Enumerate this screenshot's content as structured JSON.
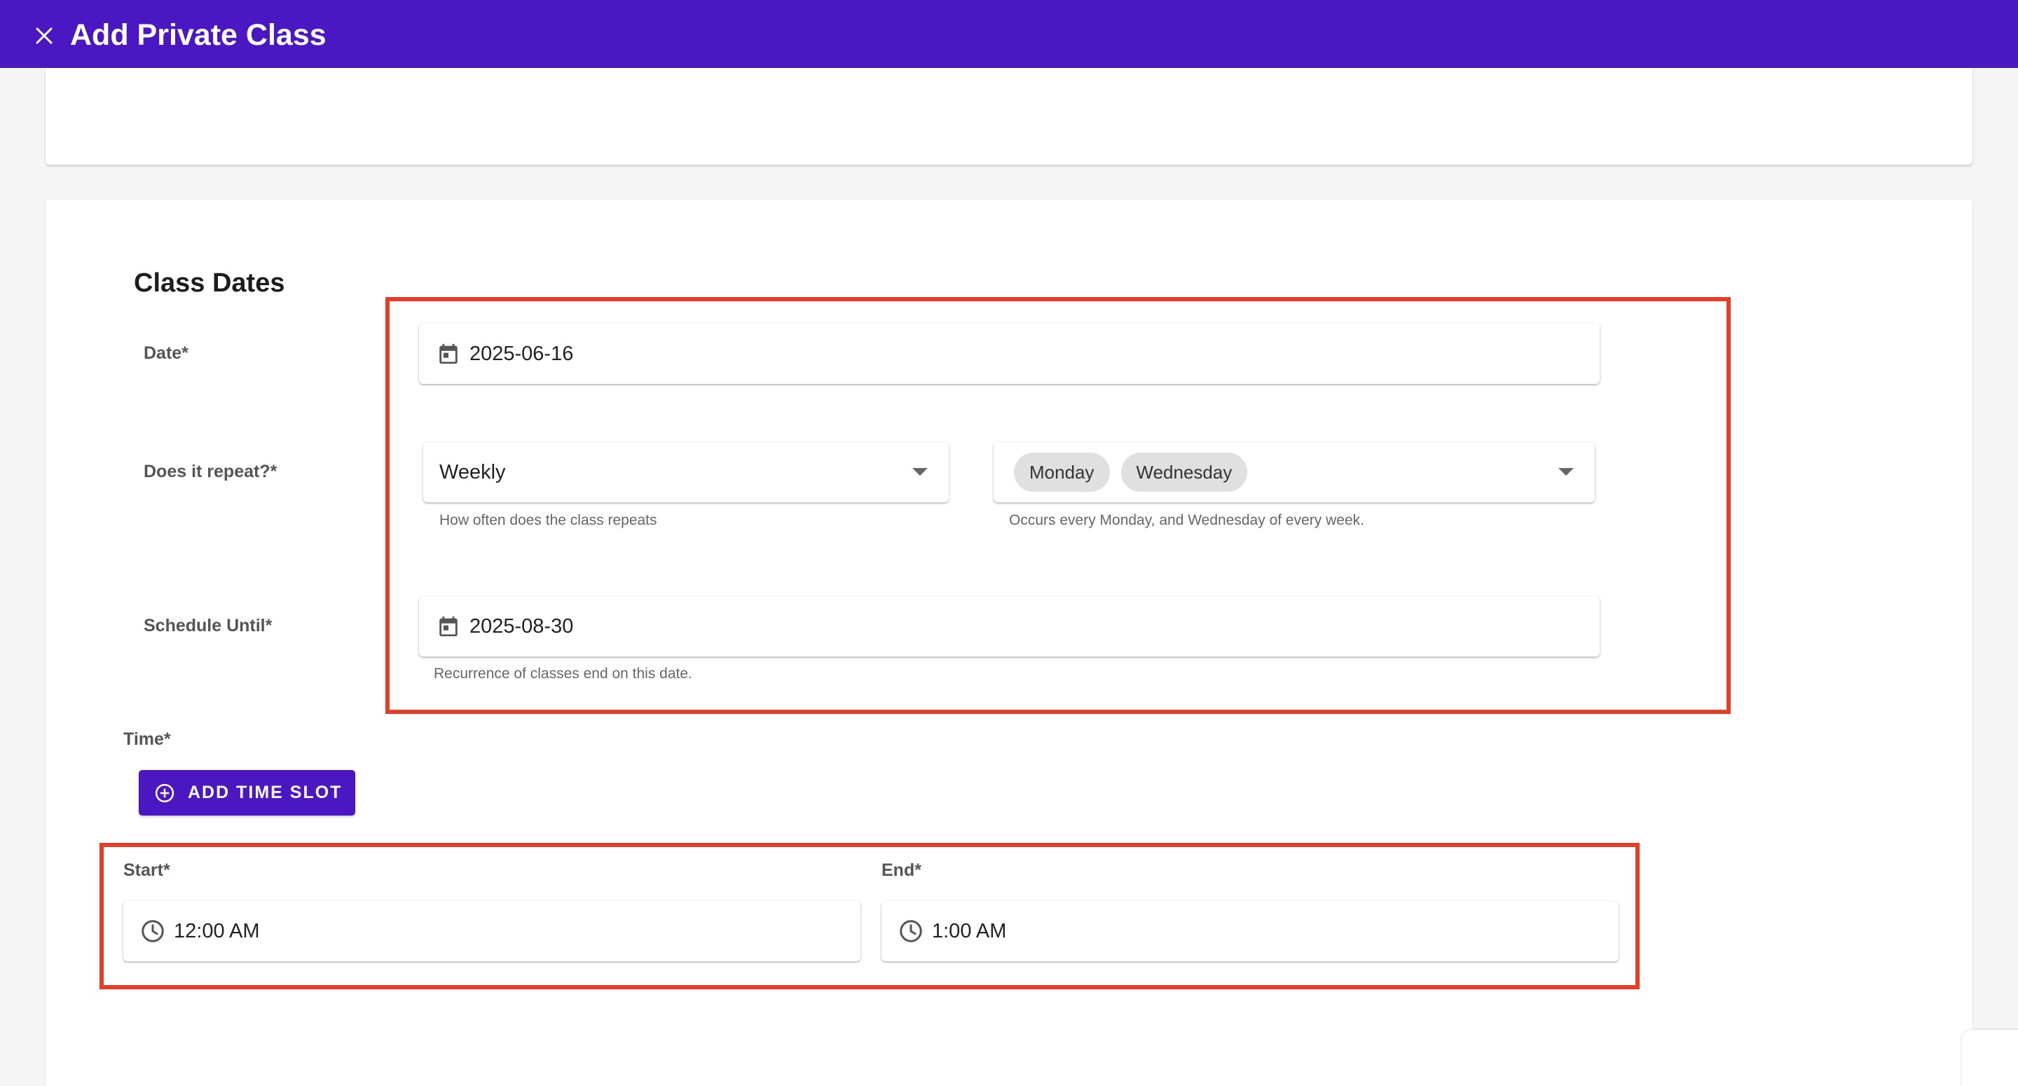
{
  "header": {
    "title": "Add Private Class",
    "close_icon": "close-icon",
    "bg_color": "#4a17c2"
  },
  "class_dates": {
    "title": "Class Dates",
    "date": {
      "label": "Date*",
      "value": "2025-06-16",
      "icon": "calendar-icon"
    },
    "repeat": {
      "label": "Does it repeat?*",
      "frequency": "Weekly",
      "frequency_helper": "How often does the class repeats",
      "days": [
        "Monday",
        "Wednesday"
      ],
      "days_helper": "Occurs every Monday, and Wednesday of every week."
    },
    "schedule_until": {
      "label": "Schedule Until*",
      "value": "2025-08-30",
      "helper": "Recurrence of classes end on this date.",
      "icon": "calendar-icon"
    }
  },
  "time": {
    "label": "Time*",
    "add_button": "ADD TIME SLOT",
    "start": {
      "label": "Start*",
      "value": "12:00 AM",
      "icon": "clock-icon"
    },
    "end": {
      "label": "End*",
      "value": "1:00 AM",
      "icon": "clock-icon"
    }
  },
  "highlight_color": "#e63d29"
}
